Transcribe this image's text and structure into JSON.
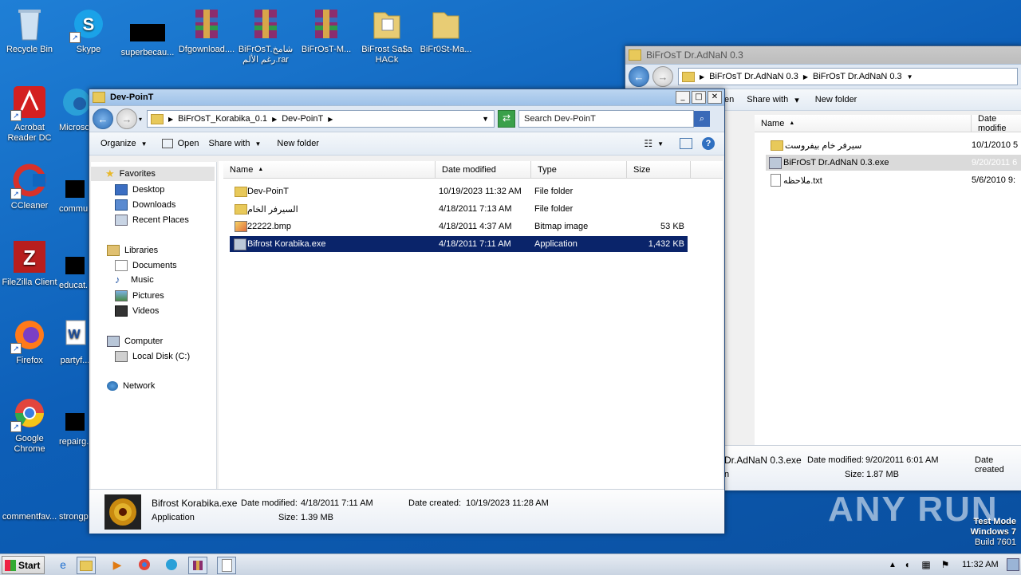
{
  "desktop": {
    "icons": [
      {
        "label": "Recycle Bin"
      },
      {
        "label": "Skype"
      },
      {
        "label": "superbecau..."
      },
      {
        "label": "Dfgownload...."
      },
      {
        "label": "BiFrOsT.شامخ رغم الألم.rar"
      },
      {
        "label": "BiFrOsT-M..."
      },
      {
        "label": "BiFrost Sa$a HACk"
      },
      {
        "label": "BiFr0St-Ma..."
      },
      {
        "label": "Acrobat Reader DC"
      },
      {
        "label": "Microso..."
      },
      {
        "label": "CCleaner"
      },
      {
        "label": "commu..."
      },
      {
        "label": "FileZilla Client"
      },
      {
        "label": "educat..."
      },
      {
        "label": "Firefox"
      },
      {
        "label": "partyf..."
      },
      {
        "label": "Google Chrome"
      },
      {
        "label": "repairg..."
      },
      {
        "label": "commentfav..."
      },
      {
        "label": "strongp..."
      }
    ]
  },
  "back_window": {
    "title": "BiFrOsT Dr.AdNaN 0.3",
    "address": [
      "BiFrOsT Dr.AdNaN 0.3",
      "BiFrOsT Dr.AdNaN 0.3"
    ],
    "toolbar": {
      "open_fragment": "en",
      "share_with": "Share with",
      "new_folder": "New folder"
    },
    "columns": {
      "name": "Name",
      "date_modified": "Date modifie"
    },
    "files": [
      {
        "name": "سيرفر خام بيفروست",
        "date": "10/1/2010 5"
      },
      {
        "name": "BiFrOsT Dr.AdNaN 0.3.exe",
        "date": "9/20/2011 6"
      },
      {
        "name": "ملاحظه.txt",
        "date": "5/6/2010 9:"
      }
    ],
    "details": {
      "name": "Dr.AdNaN 0.3.exe",
      "date_modified_label": "Date modified:",
      "date_modified": "9/20/2011 6:01 AM",
      "date_created_label": "Date created",
      "type_fragment": "n",
      "size_label": "Size:",
      "size": "1.87 MB"
    }
  },
  "front_window": {
    "title": "Dev-PoinT",
    "address": [
      "BiFrOsT_Korabika_0.1",
      "Dev-PoinT"
    ],
    "search_placeholder": "Search Dev-PoinT",
    "toolbar": {
      "organize": "Organize",
      "open": "Open",
      "share_with": "Share with",
      "new_folder": "New folder"
    },
    "nav": {
      "favorites": "Favorites",
      "desktop": "Desktop",
      "downloads": "Downloads",
      "recent": "Recent Places",
      "libraries": "Libraries",
      "documents": "Documents",
      "music": "Music",
      "pictures": "Pictures",
      "videos": "Videos",
      "computer": "Computer",
      "local_disk": "Local Disk (C:)",
      "network": "Network"
    },
    "columns": {
      "name": "Name",
      "date_modified": "Date modified",
      "type": "Type",
      "size": "Size"
    },
    "files": [
      {
        "name": "Dev-PoinT",
        "date": "10/19/2023 11:32 AM",
        "type": "File folder",
        "size": "",
        "icon": "folder-icon"
      },
      {
        "name": "السيرفر الخام",
        "date": "4/18/2011 7:13 AM",
        "type": "File folder",
        "size": "",
        "icon": "folder-icon"
      },
      {
        "name": "22222.bmp",
        "date": "4/18/2011 4:37 AM",
        "type": "Bitmap image",
        "size": "53 KB",
        "icon": "bitmap-icon"
      },
      {
        "name": "Bifrost Korabika.exe",
        "date": "4/18/2011 7:11 AM",
        "type": "Application",
        "size": "1,432 KB",
        "icon": "application-icon"
      }
    ],
    "details": {
      "name": "Bifrost Korabika.exe",
      "type": "Application",
      "date_modified_label": "Date modified:",
      "date_modified": "4/18/2011 7:11 AM",
      "date_created_label": "Date created:",
      "date_created": "10/19/2023 11:28 AM",
      "size_label": "Size:",
      "size": "1.39 MB"
    }
  },
  "taskbar": {
    "start": "Start",
    "clock": "11:32 AM"
  },
  "watermark": {
    "brand": "ANY RUN",
    "test_mode": "Test Mode",
    "os": "Windows 7",
    "build": "Build 7601"
  }
}
